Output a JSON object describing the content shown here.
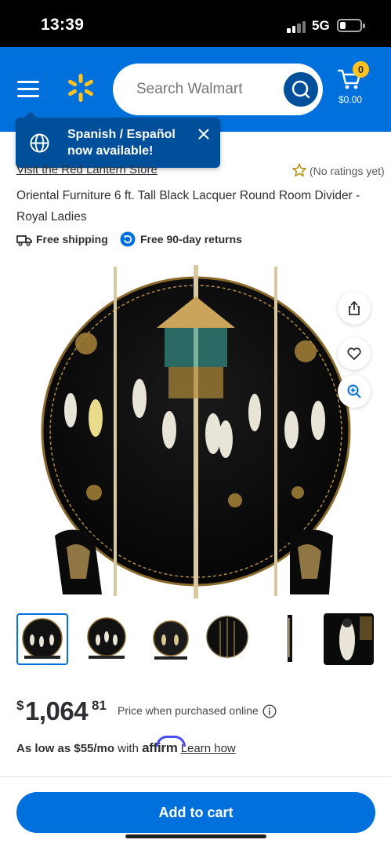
{
  "status_bar": {
    "time": "13:39",
    "network": "5G"
  },
  "header": {
    "search_placeholder": "Search Walmart",
    "cart_count": "0",
    "cart_total": "$0.00",
    "colors": {
      "brand_blue": "#0071dc",
      "dark_blue": "#004f9a",
      "spark_yellow": "#ffc220"
    }
  },
  "toast": {
    "message": "Spanish / Español now available!"
  },
  "product": {
    "store_link": "Visit the Red Lantern Store",
    "rating_text": "(No ratings yet)",
    "title": "Oriental Furniture 6 ft. Tall Black Lacquer Round Room Divider - Royal Ladies",
    "badges": [
      "Free shipping",
      "Free 90-day returns"
    ]
  },
  "gallery": {
    "thumbnail_count": 6,
    "selected_index": 0,
    "side_actions": [
      "share-icon",
      "heart-icon",
      "zoom-icon"
    ]
  },
  "pricing": {
    "currency": "$",
    "dollars": "1,064",
    "cents": "81",
    "note": "Price when purchased online",
    "affirm_prefix": "As low as $55/mo",
    "affirm_with": "with",
    "affirm_brand": "affirm",
    "affirm_link": "Learn how"
  },
  "actions": {
    "add_to_cart": "Add to cart"
  }
}
